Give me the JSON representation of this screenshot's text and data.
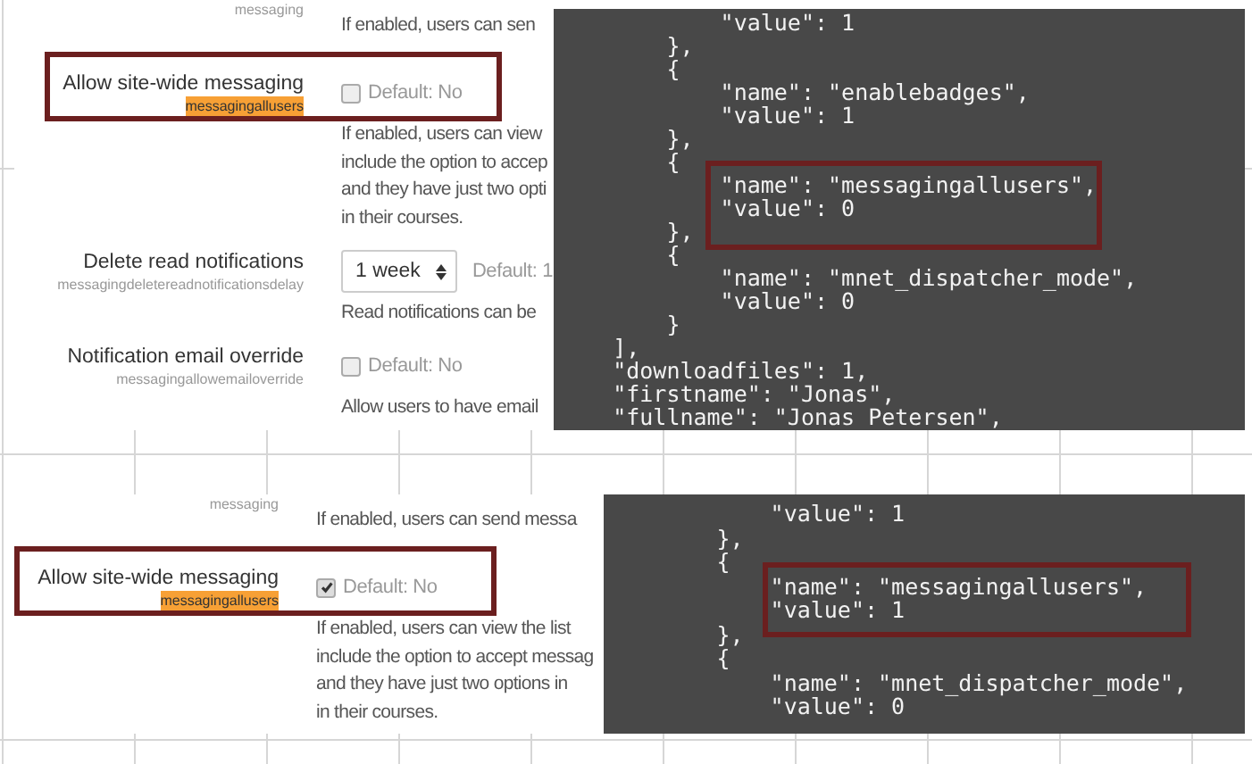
{
  "panels": [
    {
      "settings": [
        {
          "key": "messaging",
          "key_marked": false,
          "highlighted": false,
          "description": [
            "If enabled, users can sen"
          ]
        },
        {
          "label": "Allow site-wide messaging",
          "key": "messagingallusers",
          "key_marked": true,
          "highlighted": true,
          "control": {
            "kind": "checkbox",
            "checked": false,
            "default": "Default: No"
          },
          "description": [
            "If enabled, users can view",
            "include the option to accep",
            "and they have just two opti",
            "in their courses."
          ]
        },
        {
          "label": "Delete read notifications",
          "key": "messagingdeletereadnotificationsdelay",
          "key_marked": false,
          "highlighted": false,
          "control": {
            "kind": "select",
            "value": "1 week",
            "default": "Default: 1"
          },
          "description": [
            "Read notifications can be"
          ]
        },
        {
          "label": "Notification email override",
          "key": "messagingallowemailoverride",
          "key_marked": false,
          "highlighted": false,
          "control": {
            "kind": "checkbox",
            "checked": false,
            "default": "Default: No"
          },
          "description": [
            "Allow users to have email"
          ]
        }
      ],
      "terminal": {
        "blocks": [
          {
            "highlighted": false,
            "lines": [
              "            \"value\": 1",
              "        },",
              "        {",
              "            \"name\": \"enablebadges\",",
              "            \"value\": 1",
              "        },",
              "        {"
            ]
          },
          {
            "highlighted": true,
            "lines": [
              "            \"name\": \"messagingallusers\",",
              "            \"value\": 0"
            ]
          },
          {
            "highlighted": false,
            "lines": [
              "        },",
              "        {",
              "            \"name\": \"mnet_dispatcher_mode\",",
              "            \"value\": 0",
              "        }",
              "    ],",
              "    \"downloadfiles\": 1,",
              "    \"firstname\": \"Jonas\",",
              "    \"fullname\": \"Jonas Petersen\","
            ]
          }
        ]
      }
    },
    {
      "settings": [
        {
          "key": "messaging",
          "key_marked": false,
          "highlighted": false,
          "description": [
            "If enabled, users can send messa"
          ]
        },
        {
          "label": "Allow site-wide messaging",
          "key": "messagingallusers",
          "key_marked": true,
          "highlighted": true,
          "control": {
            "kind": "checkbox",
            "checked": true,
            "default": "Default: No"
          },
          "description": [
            "If enabled, users can view the list",
            "include the option to accept messag",
            "and they have just two options in",
            "in their courses."
          ]
        }
      ],
      "terminal": {
        "blocks": [
          {
            "highlighted": false,
            "lines": [
              "            \"value\": 1",
              "        },",
              "        {"
            ]
          },
          {
            "highlighted": true,
            "lines": [
              "            \"name\": \"messagingallusers\",",
              "            \"value\": 1"
            ]
          },
          {
            "highlighted": false,
            "lines": [
              "        },",
              "        {",
              "            \"name\": \"mnet_dispatcher_mode\",",
              "            \"value\": 0"
            ]
          }
        ]
      }
    }
  ]
}
